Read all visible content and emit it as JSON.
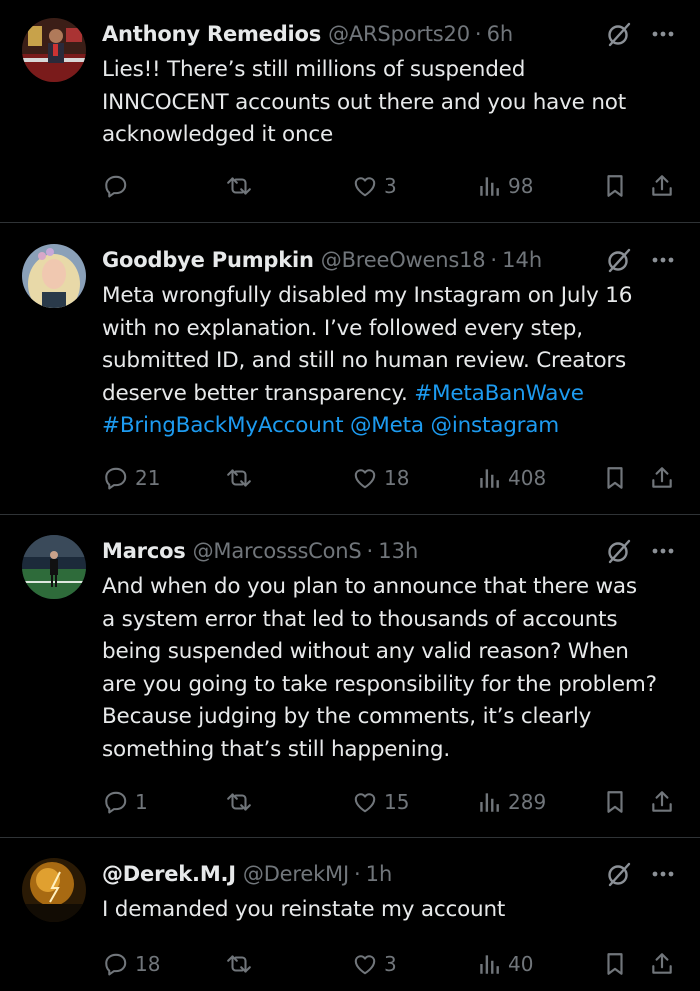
{
  "tweets": [
    {
      "name": "Anthony Remedios",
      "handle": "@ARSports20",
      "time": "6h",
      "lines": [
        [
          {
            "t": "Lies!! There’s still millions of suspended"
          }
        ],
        [
          {
            "t": "INNCOCENT accounts out there and you have not"
          }
        ],
        [
          {
            "t": "acknowledged it once"
          }
        ]
      ],
      "replies": "",
      "reposts": "",
      "likes": "3",
      "views": "98"
    },
    {
      "name": "Goodbye Pumpkin",
      "handle": "@BreeOwens18",
      "time": "14h",
      "lines": [
        [
          {
            "t": "Meta wrongfully disabled my Instagram on July 16"
          }
        ],
        [
          {
            "t": "with no explanation. I’ve followed every step,"
          }
        ],
        [
          {
            "t": "submitted ID, and still no human review. Creators"
          }
        ],
        [
          {
            "t": "deserve better transparency. "
          },
          {
            "t": "#MetaBanWave",
            "link": true
          }
        ],
        [
          {
            "t": "#BringBackMyAccount",
            "link": true
          },
          {
            "t": " "
          },
          {
            "t": "@Meta",
            "link": true
          },
          {
            "t": " "
          },
          {
            "t": "@instagram",
            "link": true
          }
        ]
      ],
      "replies": "21",
      "reposts": "",
      "likes": "18",
      "views": "408"
    },
    {
      "name": "Marcos",
      "handle": "@MarcosssConS",
      "time": "13h",
      "lines": [
        [
          {
            "t": "And when do you plan to announce that there was"
          }
        ],
        [
          {
            "t": "a system error that led to thousands of accounts"
          }
        ],
        [
          {
            "t": "being suspended without any valid reason? When"
          }
        ],
        [
          {
            "t": "are you going to take responsibility for the problem?"
          }
        ],
        [
          {
            "t": "Because judging by the comments, it’s clearly"
          }
        ],
        [
          {
            "t": "something that’s still happening."
          }
        ]
      ],
      "replies": "1",
      "reposts": "",
      "likes": "15",
      "views": "289"
    },
    {
      "name": "@Derek.M.J",
      "handle": "@DerekMJ",
      "time": "1h",
      "lines": [
        [
          {
            "t": "I demanded you reinstate my account"
          }
        ]
      ],
      "replies": "18",
      "reposts": "",
      "likes": "3",
      "views": "40"
    }
  ],
  "ui": {
    "dot": "·",
    "more_glyph": "···"
  },
  "colors": {
    "background": "#000000",
    "text": "#e7e9ea",
    "muted": "#71767b",
    "link": "#1d9bf0",
    "divider": "#2f3336"
  },
  "icons": [
    "reply-icon",
    "repost-icon",
    "like-icon",
    "views-icon",
    "bookmark-icon",
    "share-icon",
    "grok-icon",
    "more-icon"
  ]
}
